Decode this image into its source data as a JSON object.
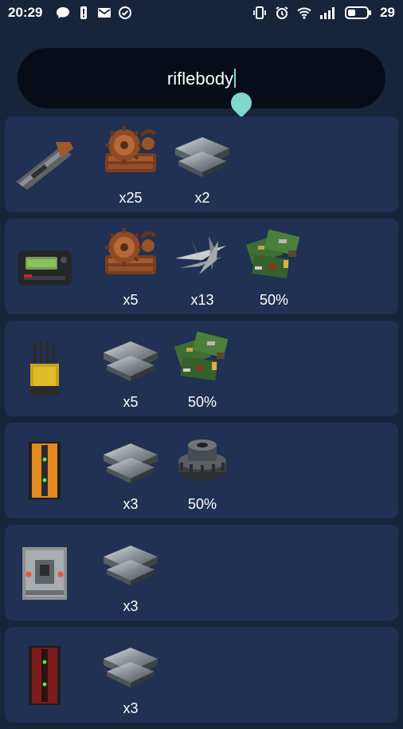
{
  "status_bar": {
    "time": "20:29",
    "battery_level": "29",
    "icons_left": [
      "chat-icon",
      "alert-icon",
      "mail-icon",
      "check-circle-icon"
    ],
    "icons_right": [
      "vibrate-icon",
      "alarm-icon",
      "wifi-icon",
      "signal-icon",
      "battery-icon"
    ]
  },
  "search": {
    "value": "riflebody"
  },
  "results": [
    {
      "item": "rifle-body-icon",
      "ingredients": [
        {
          "icon": "scrap-gears-icon",
          "label": "x25"
        },
        {
          "icon": "metal-fragments-icon",
          "label": "x2"
        }
      ]
    },
    {
      "item": "pager-icon",
      "ingredients": [
        {
          "icon": "scrap-gears-icon",
          "label": "x5"
        },
        {
          "icon": "metal-blades-icon",
          "label": "x13"
        },
        {
          "icon": "tech-trash-icon",
          "label": "50%"
        }
      ]
    },
    {
      "item": "rf-broadcaster-icon",
      "ingredients": [
        {
          "icon": "metal-fragments-icon",
          "label": "x5"
        },
        {
          "icon": "tech-trash-icon",
          "label": "50%"
        }
      ]
    },
    {
      "item": "orange-door-icon",
      "ingredients": [
        {
          "icon": "metal-fragments-icon",
          "label": "x3"
        },
        {
          "icon": "gears-icon",
          "label": "50%"
        }
      ]
    },
    {
      "item": "metal-box-icon",
      "ingredients": [
        {
          "icon": "metal-fragments-icon",
          "label": "x3"
        }
      ]
    },
    {
      "item": "red-door-icon",
      "ingredients": [
        {
          "icon": "metal-fragments-icon",
          "label": "x3"
        }
      ]
    }
  ]
}
